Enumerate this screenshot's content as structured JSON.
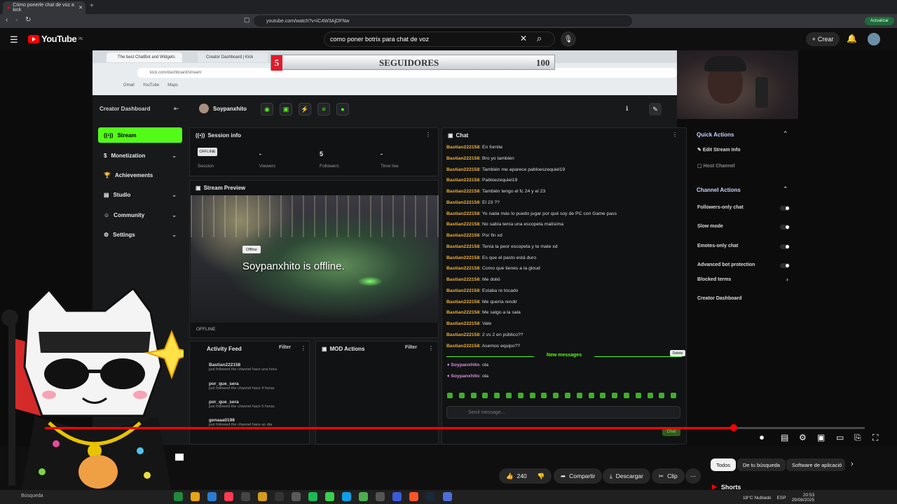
{
  "browser": {
    "tab_title": "Cómo ponerle chat de voz a kick",
    "url": "youtube.com/watch?v=iC4W3AjDFNw",
    "update_label": "Actualizar"
  },
  "youtube": {
    "logo_text": "YouTube",
    "region": "PE",
    "search_query": "como poner botrix para chat de voz",
    "create_label": "Crear"
  },
  "video": {
    "kick_tabs": [
      "The best ChatBot and Widgets",
      "Creator Dashboard | Kick"
    ],
    "kick_url": "kick.com/dashboard/stream",
    "bookmarks": [
      "Gmail",
      "YouTube",
      "Maps"
    ],
    "overlay": {
      "count": "5",
      "label": "SEGUIDORES",
      "goal": "100"
    },
    "dashboard": {
      "title": "Creator Dashboard",
      "username": "Soypanxhito",
      "nav": [
        {
          "label": "Stream",
          "active": true
        },
        {
          "label": "Monetization"
        },
        {
          "label": "Achievements"
        },
        {
          "label": "Studio"
        },
        {
          "label": "Community"
        },
        {
          "label": "Settings"
        }
      ],
      "session": {
        "title": "Session info",
        "status": "OFFLINE",
        "stats": [
          {
            "value": "-",
            "label": "Session"
          },
          {
            "value": "-",
            "label": "Viewers"
          },
          {
            "value": "5",
            "label": "Followers"
          },
          {
            "value": "-",
            "label": "Time live"
          }
        ]
      },
      "preview": {
        "title": "Stream Preview",
        "pill": "Offline",
        "message": "Soypanxhito is offline.",
        "tag": "OFFLINE"
      },
      "activity": {
        "title": "Activity Feed",
        "filter": "Filter",
        "items": [
          {
            "user": "Bastian222158",
            "text": "just followed the channel",
            "time": "hace una hora"
          },
          {
            "user": "por_que_sera",
            "text": "just followed the channel",
            "time": "hace 4 horas"
          },
          {
            "user": "por_que_sera",
            "text": "just followed the channel",
            "time": "hace 5 horas"
          },
          {
            "user": "genaaa0198",
            "text": "just followed the channel",
            "time": "hace un dia"
          }
        ]
      },
      "mod": {
        "title": "MOD Actions",
        "filter": "Filter"
      },
      "chat": {
        "title": "Chat",
        "messages": [
          {
            "user": "Bastian222158",
            "text": "En fornite"
          },
          {
            "user": "Bastian222158",
            "text": "Bro yo también"
          },
          {
            "user": "Bastian222158",
            "text": "También me aparece pabloeszequiel19"
          },
          {
            "user": "Bastian222158",
            "text": "Pabloezequiel19"
          },
          {
            "user": "Bastian222158",
            "text": "También tengo el fc 24 y el 23"
          },
          {
            "user": "Bastian222158",
            "text": "El 23 ??"
          },
          {
            "user": "Bastian222158",
            "text": "Yo nada más lo puedo jugar por qué soy de PC con Game pass"
          },
          {
            "user": "Bastian222158",
            "text": "No sabía tenía una escopeta malísima"
          },
          {
            "user": "Bastian222158",
            "text": "Por fin xd"
          },
          {
            "user": "Bastian222158",
            "text": "Tenía la peor escopeta y te mate xd"
          },
          {
            "user": "Bastian222158",
            "text": "Es que el pasto está duro"
          },
          {
            "user": "Bastian222158",
            "text": "Como que tienes a la gloud"
          },
          {
            "user": "Bastian222158",
            "text": "Me dolió"
          },
          {
            "user": "Bastian222158",
            "text": "Estaba re tocado"
          },
          {
            "user": "Bastian222158",
            "text": "Me quería rendir"
          },
          {
            "user": "Bastian222158",
            "text": "Me salgo a la sala"
          },
          {
            "user": "Bastian222158",
            "text": "Vale"
          },
          {
            "user": "Bastian222158",
            "text": "2 vs 2 en público??"
          },
          {
            "user": "Bastian222158",
            "text": "Asemos equipo??"
          }
        ],
        "new_messages": "New messages",
        "own": [
          {
            "user": "Soypanxhito",
            "text": "ola"
          },
          {
            "user": "Soypanxhito",
            "text": "ola"
          }
        ],
        "delete_tip": "Delete",
        "placeholder": "Send message...",
        "send": "Chat"
      },
      "quick_actions": {
        "title": "Quick Actions",
        "items": [
          "Edit Stream Info",
          "Host Channel"
        ]
      },
      "channel_actions": {
        "title": "Channel Actions",
        "items": [
          "Followers-only chat",
          "Slow mode",
          "Emotes-only chat",
          "Advanced bot protection",
          "Blocked terms",
          "Creator Dashboard"
        ]
      }
    },
    "progress": 0.84
  },
  "actions": {
    "likes": "240",
    "share": "Compartir",
    "download": "Descargar",
    "clip": "Clip"
  },
  "chips": [
    "Todos",
    "De tu búsqueda",
    "Software de aplicació"
  ],
  "shorts_label": "Shorts",
  "taskbar": {
    "search": "Búsqueda",
    "weather": "18°C  Nublado",
    "lang": "ESP",
    "time": "20:53",
    "date": "29/08/2025"
  },
  "colors": {
    "kick_green": "#53fc18",
    "yt_red": "#ff0000",
    "chat_user": "#f0b132"
  }
}
